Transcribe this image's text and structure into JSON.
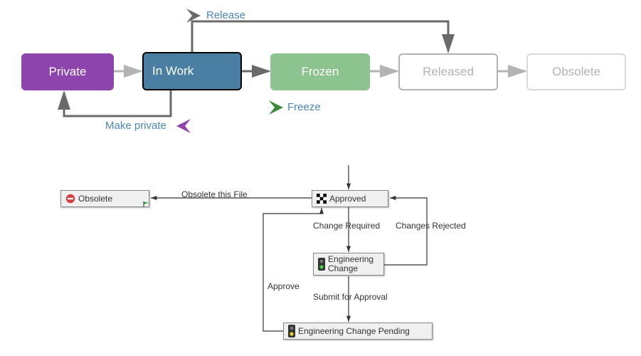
{
  "top": {
    "states": {
      "private": {
        "label": "Private",
        "bg": "#8e44ad",
        "fg": "#ffffff",
        "border": "#8e44ad"
      },
      "inwork": {
        "label": "In Work",
        "bg": "#4a7fa3",
        "fg": "#ffffff",
        "border": "#000000"
      },
      "frozen": {
        "label": "Frozen",
        "bg": "#8cc38e",
        "fg": "#ffffff",
        "border": "#8cc38e"
      },
      "released": {
        "label": "Released",
        "bg": "#ffffff",
        "fg": "#b3b3b3",
        "border": "#b3b3b3"
      },
      "obsolete": {
        "label": "Obsolete",
        "bg": "#ffffff",
        "fg": "#b3b3b3",
        "border": "#cccccc"
      }
    },
    "actions": {
      "release": {
        "label": "Release"
      },
      "freeze": {
        "label": "Freeze"
      },
      "make_private": {
        "label": "Make private"
      }
    }
  },
  "bottom": {
    "states": {
      "obsolete": {
        "label": "Obsolete"
      },
      "approved": {
        "label": "Approved"
      },
      "engchange": {
        "label": "Engineering Change"
      },
      "pending": {
        "label": "Engineering Change Pending"
      }
    },
    "transitions": {
      "obsolete_file": {
        "label": "Obsolete this File"
      },
      "change_required": {
        "label": "Change Required"
      },
      "changes_rejected": {
        "label": "Changes Rejected"
      },
      "approve": {
        "label": "Approve"
      },
      "submit": {
        "label": "Submit for Approval"
      }
    }
  }
}
